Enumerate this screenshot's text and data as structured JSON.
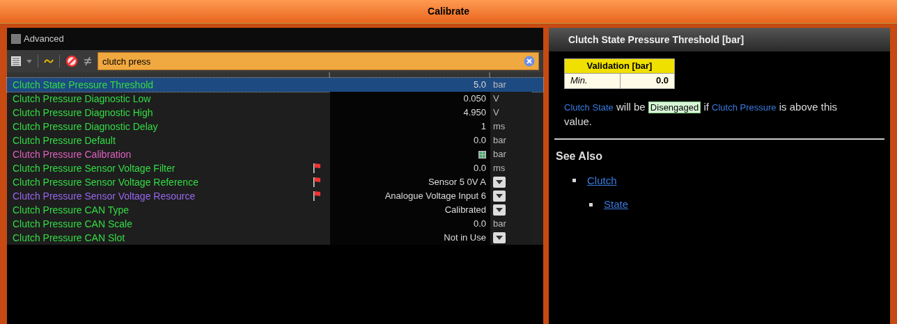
{
  "window": {
    "title": "Calibrate"
  },
  "advanced": {
    "label": "Advanced",
    "checked": false
  },
  "filter": {
    "value": "clutch press"
  },
  "rows": [
    {
      "name": "Clutch State Pressure Threshold",
      "color": "#33dd44",
      "flag": false,
      "kind": "value",
      "value": "5.0",
      "unit": "bar",
      "selected": true
    },
    {
      "name": "Clutch Pressure Diagnostic Low",
      "color": "#33dd44",
      "flag": false,
      "kind": "value",
      "value": "0.050",
      "unit": "V",
      "selected": false
    },
    {
      "name": "Clutch Pressure Diagnostic High",
      "color": "#33dd44",
      "flag": false,
      "kind": "value",
      "value": "4.950",
      "unit": "V",
      "selected": false
    },
    {
      "name": "Clutch Pressure Diagnostic Delay",
      "color": "#33dd44",
      "flag": false,
      "kind": "value",
      "value": "1",
      "unit": "ms",
      "selected": false
    },
    {
      "name": "Clutch Pressure Default",
      "color": "#33dd44",
      "flag": false,
      "kind": "value",
      "value": "0.0",
      "unit": "bar",
      "selected": false
    },
    {
      "name": "Clutch Pressure Calibration",
      "color": "#e060c0",
      "flag": false,
      "kind": "table",
      "unit": "bar",
      "selected": false
    },
    {
      "name": "Clutch Pressure Sensor Voltage Filter",
      "color": "#33dd44",
      "flag": true,
      "kind": "value",
      "value": "0.0",
      "unit": "ms",
      "selected": false
    },
    {
      "name": "Clutch Pressure Sensor Voltage Reference",
      "color": "#33dd44",
      "flag": true,
      "kind": "dropdown",
      "value": "Sensor 5 0V A",
      "selected": false
    },
    {
      "name": "Clutch Pressure Sensor Voltage Resource",
      "color": "#9966ee",
      "flag": true,
      "kind": "dropdown",
      "value": "Analogue Voltage Input 6",
      "selected": false
    },
    {
      "name": "Clutch Pressure CAN Type",
      "color": "#33dd44",
      "flag": false,
      "kind": "dropdown",
      "value": "Calibrated",
      "selected": false
    },
    {
      "name": "Clutch Pressure CAN Scale",
      "color": "#33dd44",
      "flag": false,
      "kind": "value",
      "value": "0.0",
      "unit": "bar",
      "selected": false
    },
    {
      "name": "Clutch Pressure CAN Slot",
      "color": "#33dd44",
      "flag": false,
      "kind": "dropdown",
      "value": "Not in Use",
      "selected": false
    }
  ],
  "help": {
    "title": "Clutch State Pressure Threshold [bar]",
    "validation": {
      "heading": "Validation [bar]",
      "label": "Min.",
      "value": "0.0"
    },
    "description": [
      {
        "kind": "link",
        "text": "Clutch State"
      },
      {
        "kind": "text",
        "text": " will be "
      },
      {
        "kind": "highlight",
        "text": "Disengaged"
      },
      {
        "kind": "text",
        "text": " if "
      },
      {
        "kind": "link",
        "text": "Clutch Pressure"
      },
      {
        "kind": "text",
        "text": " is above this value."
      }
    ],
    "see_also": {
      "heading": "See Also",
      "items": [
        {
          "label": "Clutch",
          "children": [
            {
              "label": "State"
            }
          ]
        }
      ]
    }
  }
}
